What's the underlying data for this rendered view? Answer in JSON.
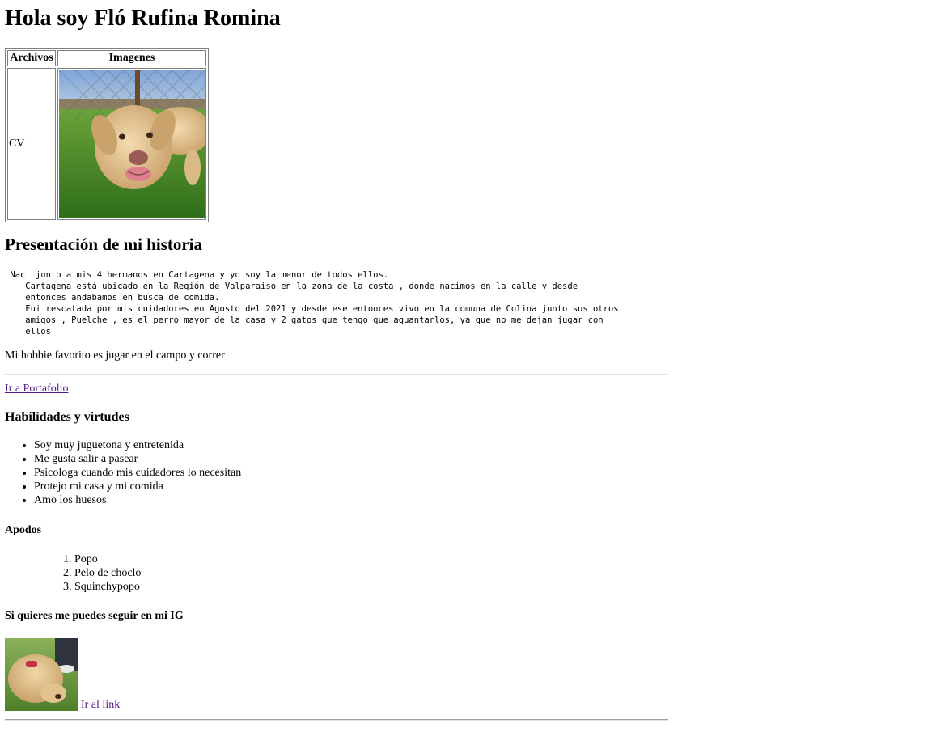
{
  "title": "Hola soy Fló Rufina Romina",
  "table": {
    "header_files": "Archivos",
    "header_images": "Imagenes",
    "cv_label": "CV",
    "photo_icon": "dog-photo"
  },
  "story": {
    "heading": "Presentación de mi historia",
    "text": " Naci junto a mis 4 hermanos en Cartagena y yo soy la menor de todos ellos.\n    Cartagena está ubicado en la Región de Valparaiso en la zona de la costa , donde nacimos en la calle y desde\n    entonces andabamos en busca de comida.\n    Fui rescatada por mis cuidadores en Agosto del 2021 y desde ese entonces vivo en la comuna de Colina junto sus otros\n    amigos , Puelche , es el perro mayor de la casa y 2 gatos que tengo que aguantarlos, ya que no me dejan jugar con\n    ellos",
    "hobby": "Mi hobbie favorito es jugar en el campo y correr"
  },
  "portfolio_link": "Ir a Portafolio",
  "skills": {
    "heading": "Habilidades y virtudes",
    "items": [
      "Soy muy juguetona y entretenida",
      "Me gusta salir a pasear",
      "Psicologa cuando mis cuidadores lo necesitan",
      "Protejo mi casa y mi comida",
      "Amo los huesos"
    ]
  },
  "nicknames": {
    "heading": "Apodos",
    "items": [
      "Popo",
      "Pelo de choclo",
      "Squinchypopo"
    ]
  },
  "instagram": {
    "heading": "Si quieres me puedes seguir en mi IG",
    "link_label": "Ir al link"
  },
  "colors": {
    "link_visited": "#551a8b",
    "rule": "#a0a0a0"
  }
}
